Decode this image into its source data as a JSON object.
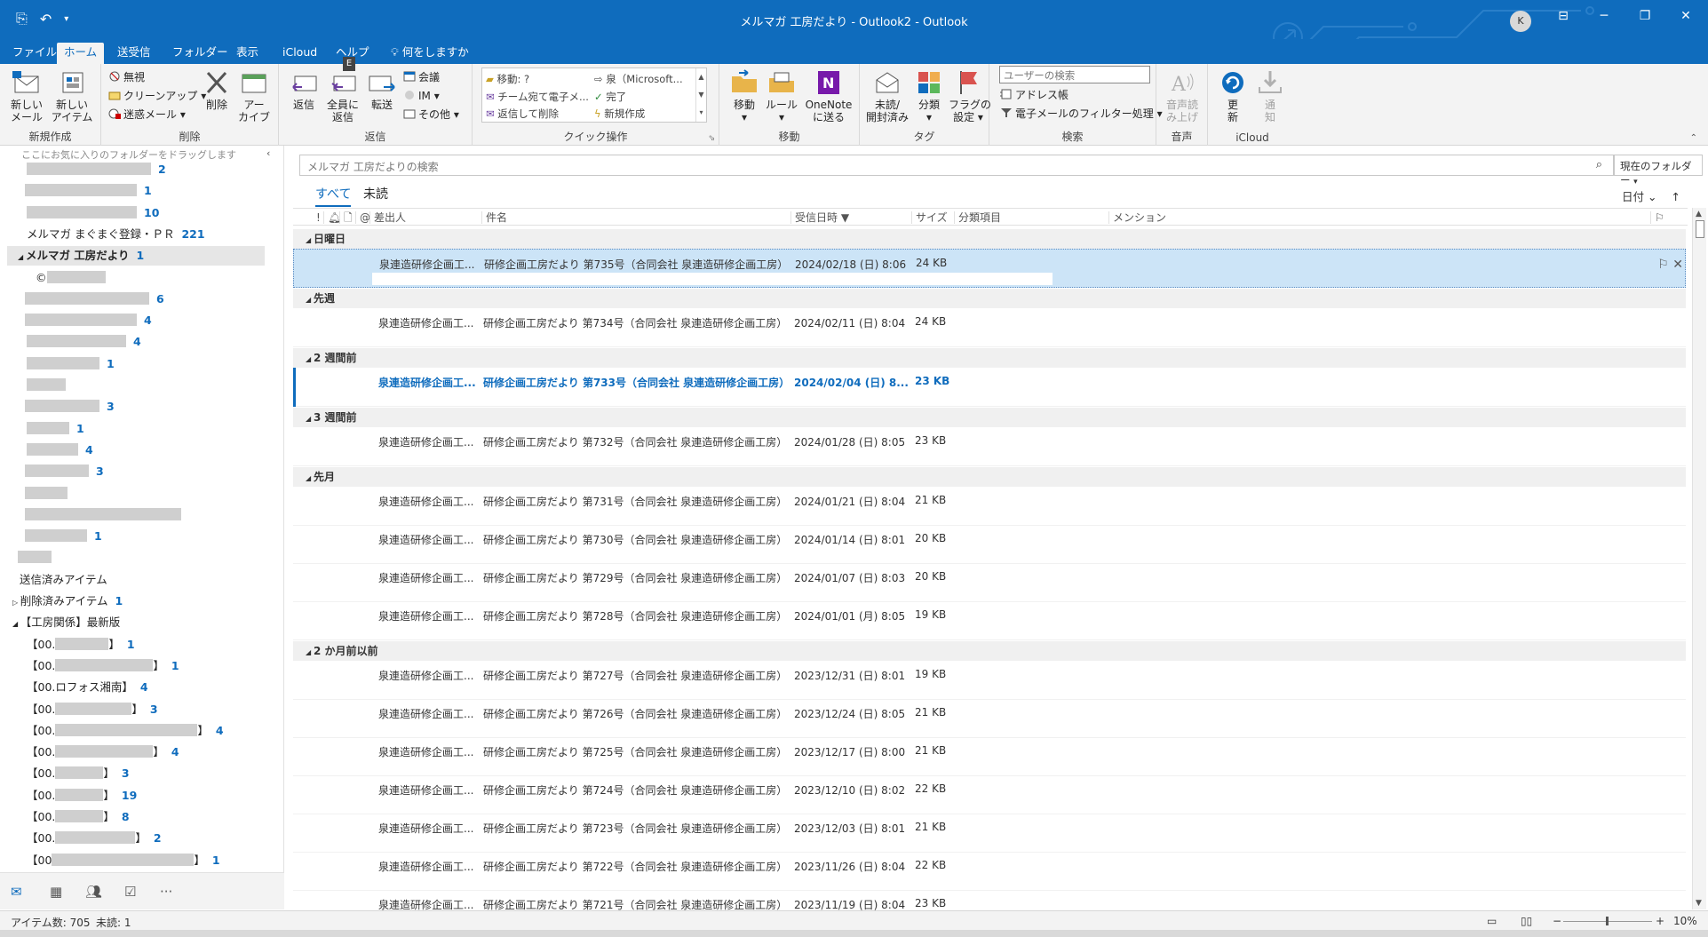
{
  "window": {
    "title": "メルマガ  工房だより - Outlook2  -  Outlook",
    "avatar_initial": "K"
  },
  "tabs": [
    {
      "label": "ファイル"
    },
    {
      "label": "ホーム"
    },
    {
      "label": "送受信"
    },
    {
      "label": "フォルダー"
    },
    {
      "label": "表示"
    },
    {
      "label": "iCloud"
    },
    {
      "label": "ヘルプ"
    },
    {
      "label": "何をしますか"
    }
  ],
  "ribbon": {
    "new": {
      "label": "新規作成",
      "new_mail": "新しい\nメール",
      "new_item": "新しい\nアイテム"
    },
    "delete": {
      "label": "削除",
      "ignore": "無視",
      "cleanup": "クリーンアップ ▾",
      "junk": "迷惑メール ▾",
      "delete": "削除",
      "archive": "アー\nカイブ"
    },
    "respond": {
      "label": "返信",
      "reply": "返信",
      "reply_all": "全員に\n返信",
      "forward": "転送",
      "meeting": "会議",
      "im": "IM ▾",
      "more": "その他 ▾",
      "key_tip": "E"
    },
    "quick_steps": {
      "label": "クイック操作",
      "items": [
        "移動: ?",
        "チーム宛て電子メ...",
        "返信して削除",
        "泉（Microsoft...",
        "完了",
        "新規作成"
      ]
    },
    "move": {
      "label": "移動",
      "move": "移動\n▾",
      "rules": "ルール\n▾",
      "onenote": "OneNote\nに送る"
    },
    "tags": {
      "label": "タグ",
      "unread": "未読/\n開封済み",
      "categorize": "分類\n▾",
      "flag": "フラグの\n設定 ▾"
    },
    "find": {
      "label": "検索",
      "search_people": "ユーザーの検索",
      "address_book": "アドレス帳",
      "filter_email": "電子メールのフィルター処理 ▾"
    },
    "speech": {
      "label": "音声",
      "read_aloud": "音声読\nみ上げ"
    },
    "icloud": {
      "label": "iCloud",
      "refresh": "更\n新",
      "notify": "通\n知"
    }
  },
  "folder_pane": {
    "drop_hint": "ここにお気に入りのフォルダーをドラッグします",
    "folders": [
      {
        "name": "",
        "count": "2"
      },
      {
        "name": "",
        "count": "1"
      },
      {
        "name": "",
        "count": "10"
      },
      {
        "name": "メルマガ  まぐまぐ登録・ＰＲ",
        "count": "221"
      },
      {
        "name": "メルマガ  工房だより",
        "count": "1"
      },
      {
        "name": "©",
        "count": ""
      },
      {
        "name": "",
        "count": "6"
      },
      {
        "name": "",
        "count": "4"
      },
      {
        "name": "",
        "count": "4"
      },
      {
        "name": "",
        "count": "1"
      },
      {
        "name": "",
        "count": ""
      },
      {
        "name": "",
        "count": "3"
      },
      {
        "name": "",
        "count": "1"
      },
      {
        "name": "",
        "count": "4"
      },
      {
        "name": "",
        "count": "3"
      },
      {
        "name": "",
        "count": ""
      },
      {
        "name": "",
        "count": ""
      },
      {
        "name": "",
        "count": "1"
      },
      {
        "name": "",
        "count": ""
      },
      {
        "name": "送信済みアイテム",
        "count": ""
      },
      {
        "name": "削除済みアイテム",
        "count": "1"
      },
      {
        "name": "【工房関係】最新版",
        "count": ""
      },
      {
        "name": "【00.",
        "count": "1"
      },
      {
        "name": "【00.",
        "count": "1"
      },
      {
        "name": "【00.ロフォス湘南】",
        "count": "4"
      },
      {
        "name": "【00.",
        "count": "3"
      },
      {
        "name": "【00.",
        "count": "4"
      },
      {
        "name": "【00.",
        "count": "4"
      },
      {
        "name": "【00.",
        "count": "3"
      },
      {
        "name": "【00.",
        "count": "19"
      },
      {
        "name": "【00.",
        "count": "8"
      },
      {
        "name": "【00.",
        "count": "2"
      },
      {
        "name": "【00",
        "count": "1"
      }
    ]
  },
  "main": {
    "search_placeholder": "メルマガ  工房だよりの検索",
    "scope": "現在のフォルダー",
    "filter_all": "すべて",
    "filter_unread": "未読",
    "sort_by": "日付 ⌄",
    "sort_dir": "↑",
    "columns": {
      "from": "差出人",
      "subject": "件名",
      "received": "受信日時",
      "size": "サイズ",
      "categories": "分類項目",
      "mention": "メンション"
    },
    "groups": [
      {
        "label": "日曜日",
        "messages": [
          {
            "from": "泉連造研修企画工...",
            "subject": "研修企画工房だより  第735号（合同会社  泉連造研修企画工房）",
            "received": "2024/02/18 (日) 8:06",
            "size": "24 KB",
            "selected": true,
            "unread": false
          }
        ]
      },
      {
        "label": "先週",
        "messages": [
          {
            "from": "泉連造研修企画工...",
            "subject": "研修企画工房だより  第734号（合同会社  泉連造研修企画工房）",
            "received": "2024/02/11 (日) 8:04",
            "size": "24 KB",
            "selected": false,
            "unread": false
          }
        ]
      },
      {
        "label": "2 週間前",
        "messages": [
          {
            "from": "泉連造研修企画工...",
            "subject": "研修企画工房だより  第733号（合同会社  泉連造研修企画工房）",
            "received": "2024/02/04 (日) 8...",
            "size": "23 KB",
            "selected": false,
            "unread": true
          }
        ]
      },
      {
        "label": "3 週間前",
        "messages": [
          {
            "from": "泉連造研修企画工...",
            "subject": "研修企画工房だより  第732号（合同会社  泉連造研修企画工房）",
            "received": "2024/01/28 (日) 8:05",
            "size": "23 KB",
            "selected": false,
            "unread": false
          }
        ]
      },
      {
        "label": "先月",
        "messages": [
          {
            "from": "泉連造研修企画工...",
            "subject": "研修企画工房だより  第731号（合同会社  泉連造研修企画工房）",
            "received": "2024/01/21 (日) 8:04",
            "size": "21 KB",
            "selected": false,
            "unread": false
          },
          {
            "from": "泉連造研修企画工...",
            "subject": "研修企画工房だより  第730号（合同会社  泉連造研修企画工房）",
            "received": "2024/01/14 (日) 8:01",
            "size": "20 KB",
            "selected": false,
            "unread": false
          },
          {
            "from": "泉連造研修企画工...",
            "subject": "研修企画工房だより  第729号（合同会社  泉連造研修企画工房）",
            "received": "2024/01/07 (日) 8:03",
            "size": "20 KB",
            "selected": false,
            "unread": false
          },
          {
            "from": "泉連造研修企画工...",
            "subject": "研修企画工房だより  第728号（合同会社  泉連造研修企画工房）",
            "received": "2024/01/01 (月) 8:05",
            "size": "19 KB",
            "selected": false,
            "unread": false
          }
        ]
      },
      {
        "label": "2 か月前以前",
        "messages": [
          {
            "from": "泉連造研修企画工...",
            "subject": "研修企画工房だより  第727号（合同会社  泉連造研修企画工房）",
            "received": "2023/12/31 (日) 8:01",
            "size": "19 KB",
            "selected": false,
            "unread": false
          },
          {
            "from": "泉連造研修企画工...",
            "subject": "研修企画工房だより  第726号（合同会社  泉連造研修企画工房）",
            "received": "2023/12/24 (日) 8:05",
            "size": "21 KB",
            "selected": false,
            "unread": false
          },
          {
            "from": "泉連造研修企画工...",
            "subject": "研修企画工房だより  第725号（合同会社  泉連造研修企画工房）",
            "received": "2023/12/17 (日) 8:00",
            "size": "21 KB",
            "selected": false,
            "unread": false
          },
          {
            "from": "泉連造研修企画工...",
            "subject": "研修企画工房だより  第724号（合同会社  泉連造研修企画工房）",
            "received": "2023/12/10 (日) 8:02",
            "size": "22 KB",
            "selected": false,
            "unread": false
          },
          {
            "from": "泉連造研修企画工...",
            "subject": "研修企画工房だより  第723号（合同会社  泉連造研修企画工房）",
            "received": "2023/12/03 (日) 8:01",
            "size": "21 KB",
            "selected": false,
            "unread": false
          },
          {
            "from": "泉連造研修企画工...",
            "subject": "研修企画工房だより  第722号（合同会社  泉連造研修企画工房）",
            "received": "2023/11/26 (日) 8:04",
            "size": "22 KB",
            "selected": false,
            "unread": false
          },
          {
            "from": "泉連造研修企画工...",
            "subject": "研修企画工房だより  第721号（合同会社  泉連造研修企画工房）",
            "received": "2023/11/19 (日) 8:04",
            "size": "23 KB",
            "selected": false,
            "unread": false
          }
        ]
      }
    ]
  },
  "status": {
    "items": "アイテム数: 705",
    "unread": "未読: 1",
    "zoom": "10%"
  },
  "colors": {
    "accent": "#0f6cbd",
    "selected_row": "#cce4f7",
    "group_bg": "#f0f0f0"
  }
}
